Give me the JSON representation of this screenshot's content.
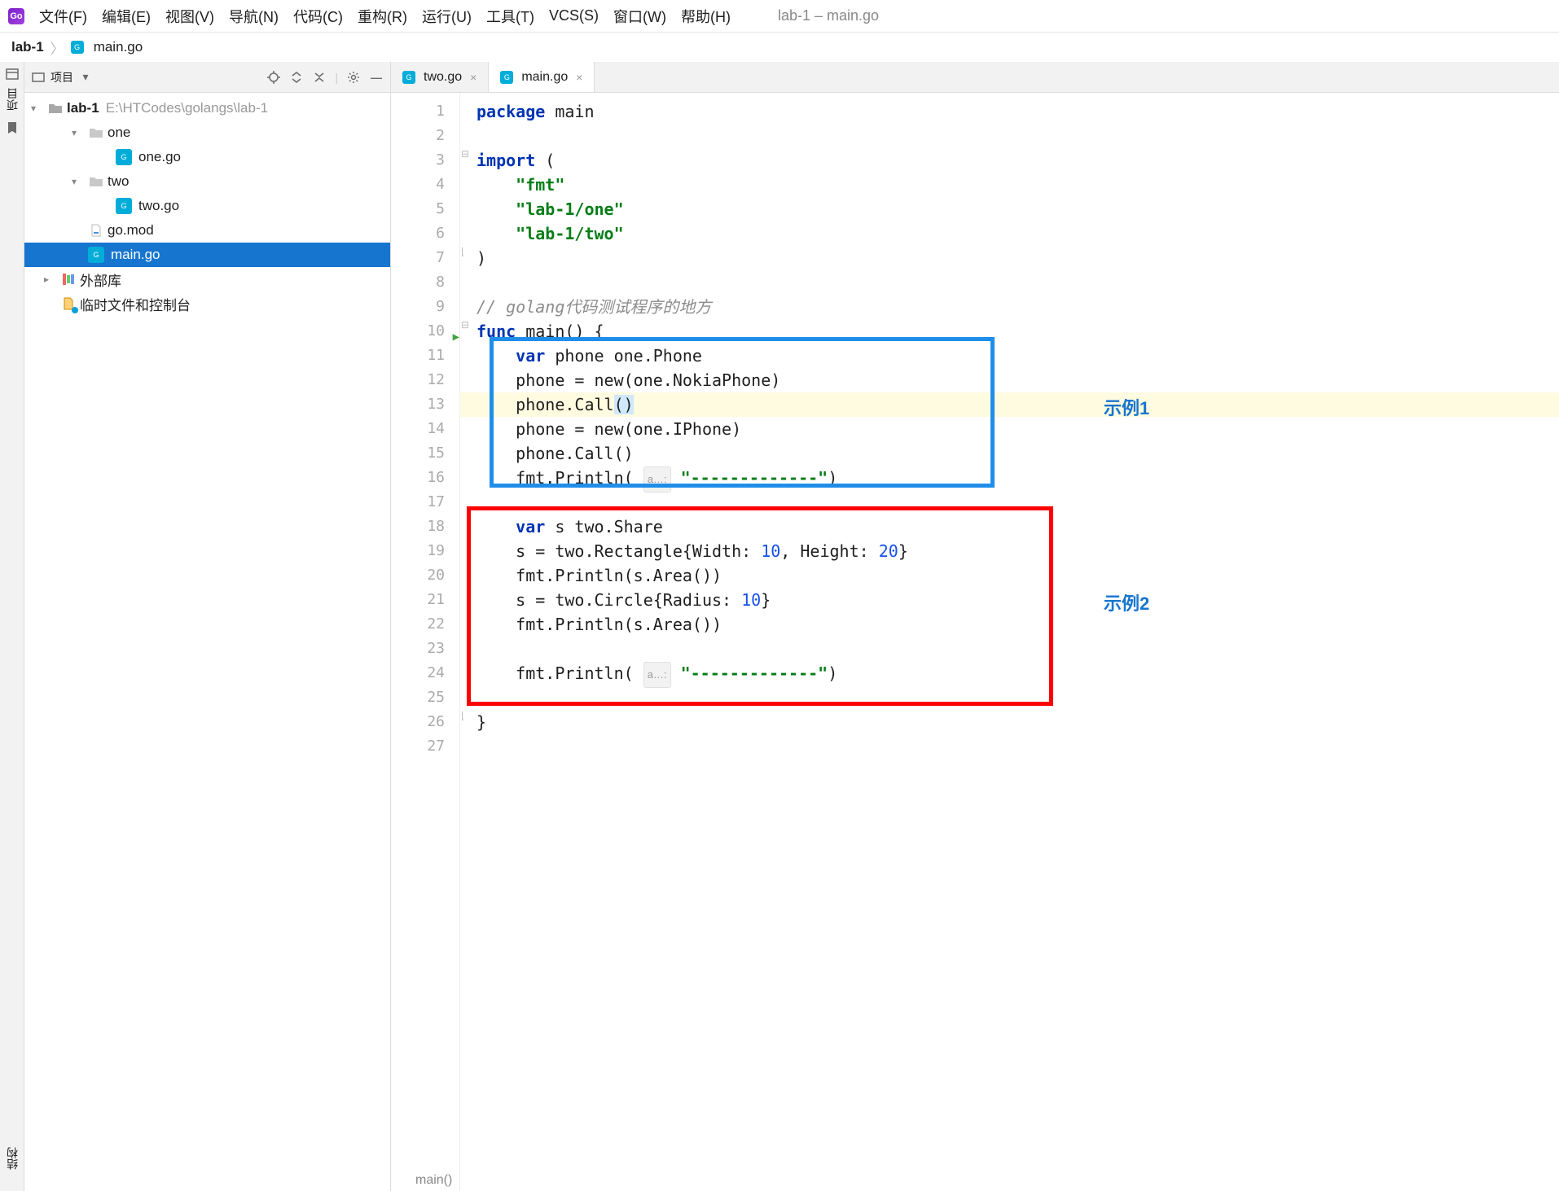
{
  "title_right": "lab-1 – main.go",
  "menu": [
    "文件(F)",
    "编辑(E)",
    "视图(V)",
    "导航(N)",
    "代码(C)",
    "重构(R)",
    "运行(U)",
    "工具(T)",
    "VCS(S)",
    "窗口(W)",
    "帮助(H)"
  ],
  "breadcrumb": {
    "project": "lab-1",
    "file": "main.go"
  },
  "left_strip": {
    "project": "项目",
    "structure": "结构"
  },
  "project_toolbar": {
    "label": "项目"
  },
  "tree": {
    "root": "lab-1",
    "root_path": "E:\\HTCodes\\golangs\\lab-1",
    "one": "one",
    "one_go": "one.go",
    "two": "two",
    "two_go": "two.go",
    "go_mod": "go.mod",
    "main_go": "main.go",
    "ext_lib": "外部库",
    "scratch": "临时文件和控制台"
  },
  "tabs": [
    {
      "label": "two.go",
      "active": false
    },
    {
      "label": "main.go",
      "active": true
    }
  ],
  "annotations": {
    "ex1": "示例1",
    "ex2": "示例2"
  },
  "status": "main()",
  "code": {
    "l1a": "package",
    "l1b": " main",
    "l3a": "import",
    "l3b": " (",
    "l4": "\"fmt\"",
    "l5": "\"lab-1/one\"",
    "l6": "\"lab-1/two\"",
    "l7": ")",
    "l9": "// golang代码测试程序的地方",
    "l10a": "func",
    "l10b": " main() {",
    "l11a": "var",
    "l11b": " phone one.Phone",
    "l12": "    phone = new(one.NokiaPhone)",
    "l13a": "    phone.Call",
    "l13b": "()",
    "l14": "    phone = new(one.IPhone)",
    "l15": "    phone.Call()",
    "l16a": "    fmt.Println( ",
    "hint": "a…:",
    "l16b": " ",
    "l16c": "\"-------------\"",
    "l16d": ")",
    "l18a": "var",
    "l18b": " s two.Share",
    "l19a": "    s = two.Rectangle{Width: ",
    "l19b": "10",
    "l19c": ", Height: ",
    "l19d": "20",
    "l19e": "}",
    "l20": "    fmt.Println(s.Area())",
    "l21a": "    s = two.Circle{Radius: ",
    "l21b": "10",
    "l21c": "}",
    "l22": "    fmt.Println(s.Area())",
    "l24a": "    fmt.Println( ",
    "l24c": "\"-------------\"",
    "l24d": ")",
    "l26": "}"
  }
}
